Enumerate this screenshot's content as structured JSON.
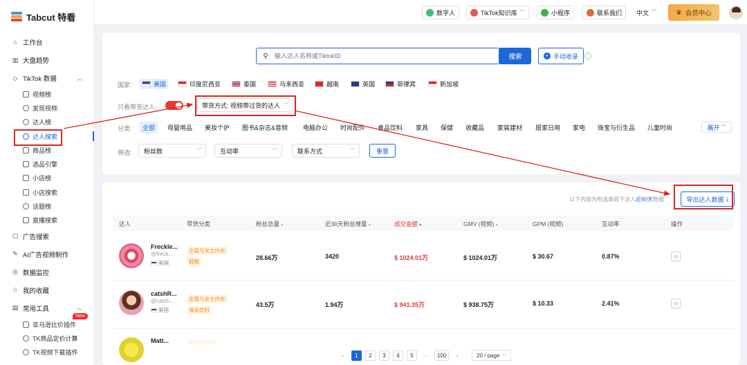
{
  "brand": {
    "name": "Tabcut 特看"
  },
  "topbar": {
    "digital_human": "数字人",
    "tiktok_kb": "TikTok知识库",
    "mini_program": "小程序",
    "contact": "联系我们",
    "language": "中文",
    "vip": "会员中心"
  },
  "sidebar": {
    "workbench": "工作台",
    "market_trend": "大盘趋势",
    "tiktok_data": "TikTok 数据",
    "sub": {
      "video_rank": "视频榜",
      "discover_video": "发现视频",
      "kol_rank": "达人榜",
      "kol_search": "达人搜索",
      "product_rank": "商品榜",
      "product_engine": "选品引擎",
      "shop_rank": "小店榜",
      "shop_search": "小店搜索",
      "topic_rank": "话题榜",
      "live_search": "直播搜索"
    },
    "ad_search": "广告搜索",
    "ai_ad_video": "AI广告视频制作",
    "data_monitor": "数据监控",
    "my_favorites": "我的收藏",
    "common_tools": "常用工具",
    "tools": {
      "amazon_plugin": "亚马逊比价插件",
      "new_badge": "New",
      "tk_pricing": "TK商品定价计算",
      "tk_video_dl": "TK视频下载插件"
    }
  },
  "search": {
    "placeholder": "输入达人名称或TiktokID",
    "button": "搜索",
    "manual_add": "手动收录"
  },
  "filters": {
    "country_label": "国家:",
    "countries": [
      "美国",
      "印度尼西亚",
      "泰国",
      "马来西亚",
      "越南",
      "英国",
      "菲律宾",
      "新加坡"
    ],
    "only_seller_label": "只看带货达人:",
    "sell_method": "带货方式: 视频带过货的达人",
    "category_label": "分类:",
    "categories": [
      "全部",
      "母婴用品",
      "美妆个护",
      "图书&杂志&音频",
      "电脑办公",
      "时尚配件",
      "食品饮料",
      "家具",
      "保健",
      "收藏品",
      "家装建材",
      "居家日用",
      "家电",
      "珠宝与衍生品",
      "儿童时尚"
    ],
    "expand": "展开",
    "filter_label": "筛选:",
    "fans": "粉丝数",
    "engagement": "互动率",
    "contact_method": "联系方式",
    "reset": "重置"
  },
  "results": {
    "note_prefix": "以下内容为所选类目下达人",
    "note_highlight": "近90天",
    "note_suffix": "数据",
    "export": "导出达人数据",
    "columns": [
      "达人",
      "带货分类",
      "粉丝总量",
      "近30天粉丝增量",
      "成交金额",
      "GMV (视频)",
      "GPM (视频)",
      "互动率",
      "操作"
    ],
    "rows": [
      {
        "name": "Freckle...",
        "handle": "@freck...",
        "country": "美国",
        "tags": [
          "女装与女士内衣",
          "鞋靴"
        ],
        "fans": "28.66万",
        "growth": "3420",
        "sales": "$ 1024.01万",
        "gmv": "$ 1024.01万",
        "gpm": "$ 30.67",
        "engagement": "0.87%"
      },
      {
        "name": "catshR...",
        "handle": "@catsh...",
        "country": "美国",
        "tags": [
          "女装与女士内衣",
          "食品饮料"
        ],
        "fans": "43.5万",
        "growth": "1.94万",
        "sales": "$ 941.35万",
        "gmv": "$ 938.75万",
        "gpm": "$ 10.33",
        "engagement": "2.41%"
      },
      {
        "name": "Matt...",
        "handle": "",
        "country": "",
        "tags": [],
        "fans": "",
        "growth": "",
        "sales": "",
        "gmv": "",
        "gpm": "",
        "engagement": ""
      }
    ]
  },
  "pagination": {
    "pages": [
      "1",
      "2",
      "3",
      "4",
      "5",
      "···",
      "100"
    ],
    "current": "1",
    "page_size": "20 / page"
  },
  "colors": {
    "accent": "#1a67d8",
    "danger": "#e53935",
    "tag_bg": "#fff5e6",
    "tag_text": "#f08c1a"
  }
}
